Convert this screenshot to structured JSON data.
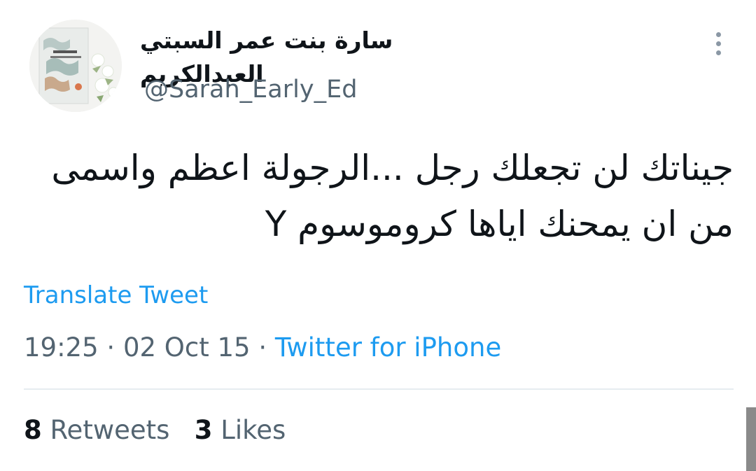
{
  "author": {
    "display_name": "سارة بنت عمر السبتي العبدالكريم",
    "handle": "@Sarah_Early_Ed",
    "avatar_icon": "book-cover-avatar"
  },
  "more_icon": "more-vertical-icon",
  "tweet": {
    "lines": [
      "جيناتك لن تجعلك رجل ...الرجولة اعظم واسمى",
      "من ان يمحنك اياها كروموسوم Y"
    ]
  },
  "translate_label": "Translate Tweet",
  "meta": {
    "time": "19:25",
    "separator": " · ",
    "date": "02 Oct 15",
    "source": "Twitter for iPhone"
  },
  "stats": {
    "retweets_count": "8",
    "retweets_label": "Retweets",
    "likes_count": "3",
    "likes_label": "Likes"
  },
  "colors": {
    "link": "#1d9bf0",
    "secondary_text": "#536471",
    "primary_text": "#0f1419"
  }
}
